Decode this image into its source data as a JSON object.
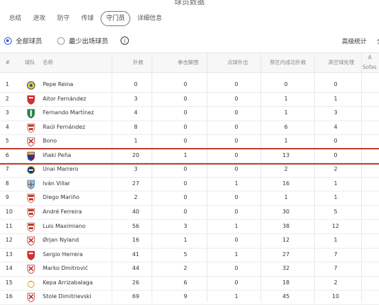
{
  "page": {
    "title": "球员数据"
  },
  "tabs": [
    {
      "label": "总结"
    },
    {
      "label": "进攻"
    },
    {
      "label": "防守"
    },
    {
      "label": "传球"
    },
    {
      "label": "守门员"
    },
    {
      "label": "详细信息"
    }
  ],
  "active_tab": 4,
  "filters": {
    "all_players": "全部球员",
    "min_appearance": "最少出场球员",
    "info_icon": "info-icon",
    "advanced_stats": "高级统计",
    "full_label": "全"
  },
  "columns": {
    "rank": "#",
    "team": "球队",
    "name": "名称",
    "saves": "扑救",
    "punches": "拳击解围",
    "pen_saves": "点球扑出",
    "box_saves": "禁区内成功扑救",
    "high_claims": "高空球处理",
    "extra_top": "A",
    "extra_bottom": "Sofas"
  },
  "rows": [
    {
      "rank": "1",
      "name": "Pepe Reina",
      "saves": "0",
      "punches": "0",
      "pen": "0",
      "box": "0",
      "claims": "0",
      "crest": "yellow"
    },
    {
      "rank": "2",
      "name": "Aitor Fernández",
      "saves": "3",
      "punches": "0",
      "pen": "0",
      "box": "1",
      "claims": "1",
      "crest": "red"
    },
    {
      "rank": "3",
      "name": "Fernando Martínez",
      "saves": "4",
      "punches": "0",
      "pen": "0",
      "box": "1",
      "claims": "3",
      "crest": "green"
    },
    {
      "rank": "4",
      "name": "Raúl Fernández",
      "saves": "8",
      "punches": "0",
      "pen": "0",
      "box": "6",
      "claims": "4",
      "crest": "granada"
    },
    {
      "rank": "5",
      "name": "Bono",
      "saves": "1",
      "punches": "0",
      "pen": "0",
      "box": "1",
      "claims": "0",
      "crest": "sevilla"
    },
    {
      "rank": "6",
      "name": "Iñaki Peña",
      "saves": "20",
      "punches": "1",
      "pen": "0",
      "box": "13",
      "claims": "0",
      "crest": "barca"
    },
    {
      "rank": "7",
      "name": "Unai Marrero",
      "saves": "3",
      "punches": "0",
      "pen": "0",
      "box": "2",
      "claims": "2",
      "crest": "sociedad"
    },
    {
      "rank": "8",
      "name": "Iván Villar",
      "saves": "27",
      "punches": "0",
      "pen": "1",
      "box": "16",
      "claims": "1",
      "crest": "celta"
    },
    {
      "rank": "9",
      "name": "Diego Mariño",
      "saves": "2",
      "punches": "0",
      "pen": "0",
      "box": "1",
      "claims": "1",
      "crest": "granada"
    },
    {
      "rank": "10",
      "name": "André Ferreira",
      "saves": "40",
      "punches": "0",
      "pen": "0",
      "box": "30",
      "claims": "5",
      "crest": "granada"
    },
    {
      "rank": "11",
      "name": "Luis Maximiano",
      "saves": "56",
      "punches": "3",
      "pen": "1",
      "box": "38",
      "claims": "12",
      "crest": "granada"
    },
    {
      "rank": "12",
      "name": "Ørjan Nyland",
      "saves": "16",
      "punches": "1",
      "pen": "0",
      "box": "12",
      "claims": "1",
      "crest": "sevilla"
    },
    {
      "rank": "13",
      "name": "Sergio Herrera",
      "saves": "41",
      "punches": "5",
      "pen": "1",
      "box": "27",
      "claims": "7",
      "crest": "red"
    },
    {
      "rank": "14",
      "name": "Marko Dmitrović",
      "saves": "44",
      "punches": "2",
      "pen": "0",
      "box": "32",
      "claims": "7",
      "crest": "sevilla"
    },
    {
      "rank": "15",
      "name": "Kepa Arrizabalaga",
      "saves": "26",
      "punches": "6",
      "pen": "0",
      "box": "18",
      "claims": "2",
      "crest": "madrid"
    },
    {
      "rank": "16",
      "name": "Stole Dimitrievski",
      "saves": "69",
      "punches": "9",
      "pen": "1",
      "box": "45",
      "claims": "10",
      "crest": "sevilla"
    }
  ],
  "highlight_row": 6
}
